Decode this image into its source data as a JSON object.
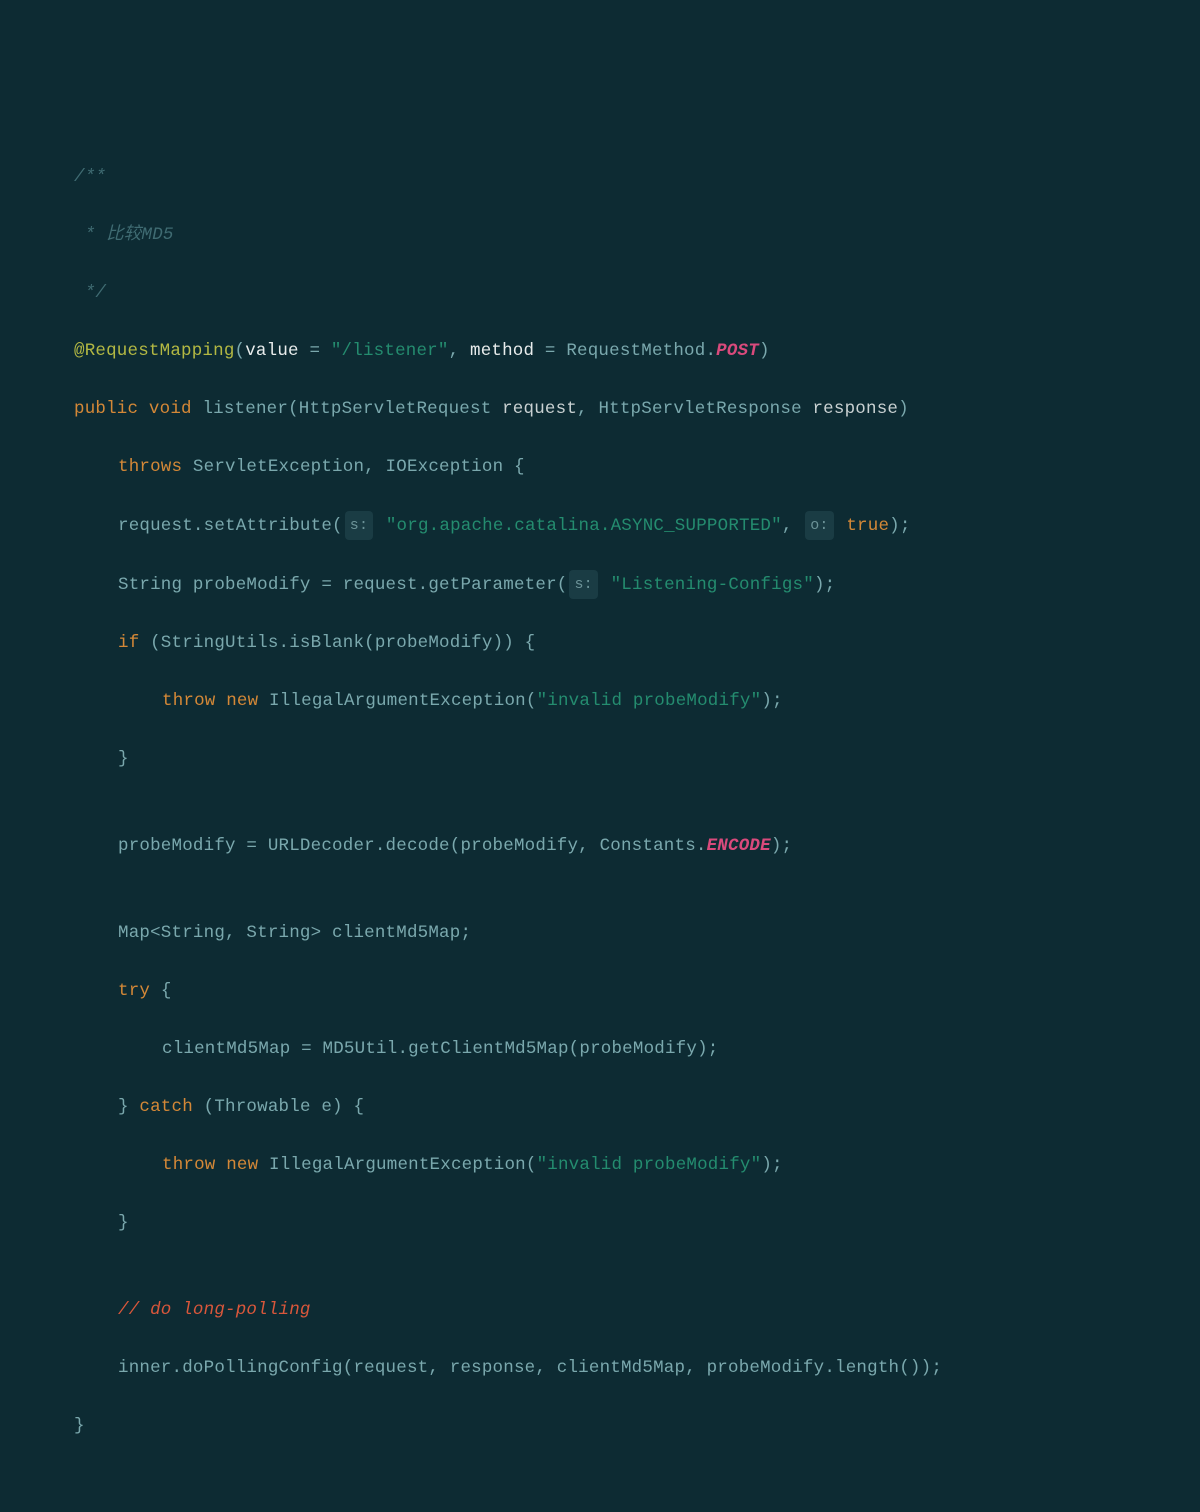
{
  "lines": {
    "l1": "/**",
    "l2_star": " * ",
    "l2_text": "比较MD5",
    "l3": " */",
    "l4_anno": "@RequestMapping",
    "l4_lp": "(",
    "l4_value": "value",
    "l4_eq1": " = ",
    "l4_str1": "\"/listener\"",
    "l4_comma": ", ",
    "l4_method": "method",
    "l4_eq2": " = ",
    "l4_rm": "RequestMethod",
    "l4_dot": ".",
    "l4_post": "POST",
    "l4_rp": ")",
    "l5_public": "public",
    "l5_sp1": " ",
    "l5_void": "void",
    "l5_sp2": " ",
    "l5_name": "listener",
    "l5_lp": "(",
    "l5_t1": "HttpServletRequest ",
    "l5_p1": "request",
    "l5_c1": ", ",
    "l5_t2": "HttpServletResponse ",
    "l5_p2": "response",
    "l5_rp": ")",
    "l6_throws": "throws",
    "l6_sp": " ",
    "l6_ex": "ServletException, IOException ",
    "l6_brace": "{",
    "l7_pre": "request.setAttribute(",
    "l7_hint1": "s:",
    "l7_sp1": " ",
    "l7_str": "\"org.apache.catalina.ASYNC_SUPPORTED\"",
    "l7_c": ", ",
    "l7_hint2": "o:",
    "l7_sp2": " ",
    "l7_true": "true",
    "l7_end": ");",
    "l8_a": "String probeModify = request.getParameter(",
    "l8_hint": "s:",
    "l8_sp": " ",
    "l8_str": "\"Listening-Configs\"",
    "l8_end": ");",
    "l9_if": "if",
    "l9_sp": " ",
    "l9_rest": "(StringUtils.isBlank(probeModify)) {",
    "l10_throw": "throw",
    "l10_sp1": " ",
    "l10_new": "new",
    "l10_sp2": " ",
    "l10_cls": "IllegalArgumentException(",
    "l10_str": "\"invalid probeModify\"",
    "l10_end": ");",
    "l11": "}",
    "l12": "",
    "l13_a": "probeModify = URLDecoder.decode(probeModify, Constants.",
    "l13_enc": "ENCODE",
    "l13_end": ");",
    "l14": "",
    "l15": "Map<String, String> clientMd5Map;",
    "l16_try": "try",
    "l16_sp": " ",
    "l16_brace": "{",
    "l17": "clientMd5Map = MD5Util.getClientMd5Map(probeModify);",
    "l18_rb": "} ",
    "l18_catch": "catch",
    "l18_sp": " ",
    "l18_rest": "(Throwable e) {",
    "l19_throw": "throw",
    "l19_sp1": " ",
    "l19_new": "new",
    "l19_sp2": " ",
    "l19_cls": "IllegalArgumentException(",
    "l19_str": "\"invalid probeModify\"",
    "l19_end": ");",
    "l20": "}",
    "l21": "",
    "l22": "// do long-polling",
    "l23": "inner.doPollingConfig(request, response, clientMd5Map, probeModify.length());",
    "l24": "}"
  }
}
